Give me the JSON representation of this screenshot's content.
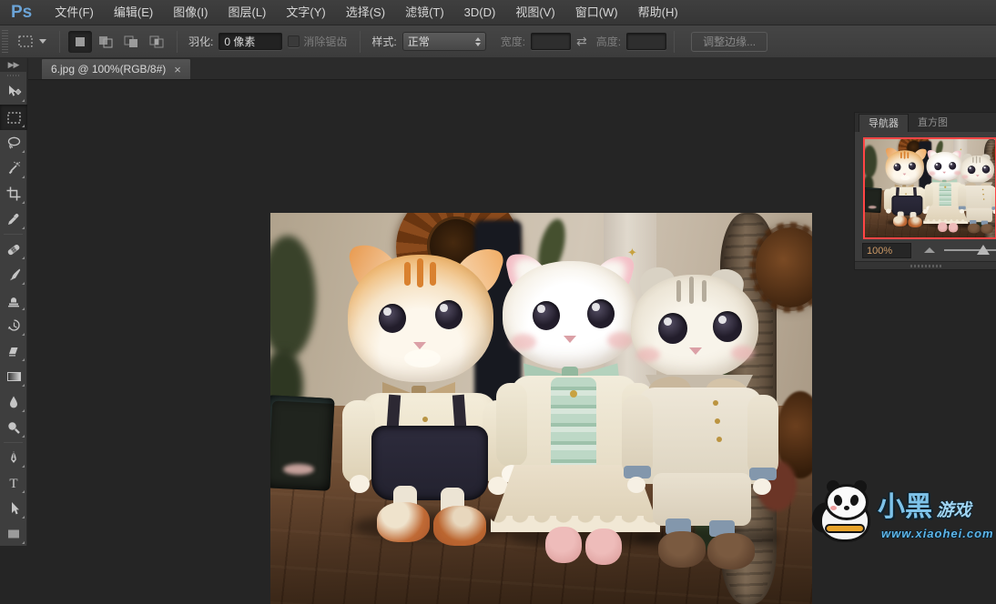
{
  "app": {
    "logo": "Ps"
  },
  "menubar": {
    "items": [
      {
        "label": "文件(F)"
      },
      {
        "label": "编辑(E)"
      },
      {
        "label": "图像(I)"
      },
      {
        "label": "图层(L)"
      },
      {
        "label": "文字(Y)"
      },
      {
        "label": "选择(S)"
      },
      {
        "label": "滤镜(T)"
      },
      {
        "label": "3D(D)"
      },
      {
        "label": "视图(V)"
      },
      {
        "label": "窗口(W)"
      },
      {
        "label": "帮助(H)"
      }
    ]
  },
  "options": {
    "feather_label": "羽化:",
    "feather_value": "0 像素",
    "antialias_label": "消除锯齿",
    "style_label": "样式:",
    "style_value": "正常",
    "width_label": "宽度:",
    "width_value": "",
    "height_label": "高度:",
    "height_value": "",
    "refine_edge_label": "调整边缘..."
  },
  "tabbar": {
    "title": "6.jpg @ 100%(RGB/8#)",
    "close_label": "×"
  },
  "toolbar": {
    "collapse_label": "▶▶",
    "tools": [
      "移动工具",
      "矩形选框工具",
      "套索工具",
      "魔棒工具",
      "裁剪工具",
      "吸管工具",
      "污点修复画笔工具",
      "画笔工具",
      "仿制图章工具",
      "历史记录画笔工具",
      "橡皮擦工具",
      "渐变工具",
      "模糊工具",
      "减淡工具",
      "钢笔工具",
      "横排文字工具",
      "路径选择工具",
      "矩形工具"
    ]
  },
  "navigator": {
    "tab_navigator": "导航器",
    "tab_histogram": "直方图",
    "zoom_value": "100%"
  },
  "watermark": {
    "brand_main": "小黑",
    "brand_sub": "游戏",
    "url": "www.xiaohei.com"
  },
  "colors": {
    "accent_blue": "#6ba3d6",
    "navigator_view_border": "#ff4545",
    "pasteboard": "#252525"
  }
}
